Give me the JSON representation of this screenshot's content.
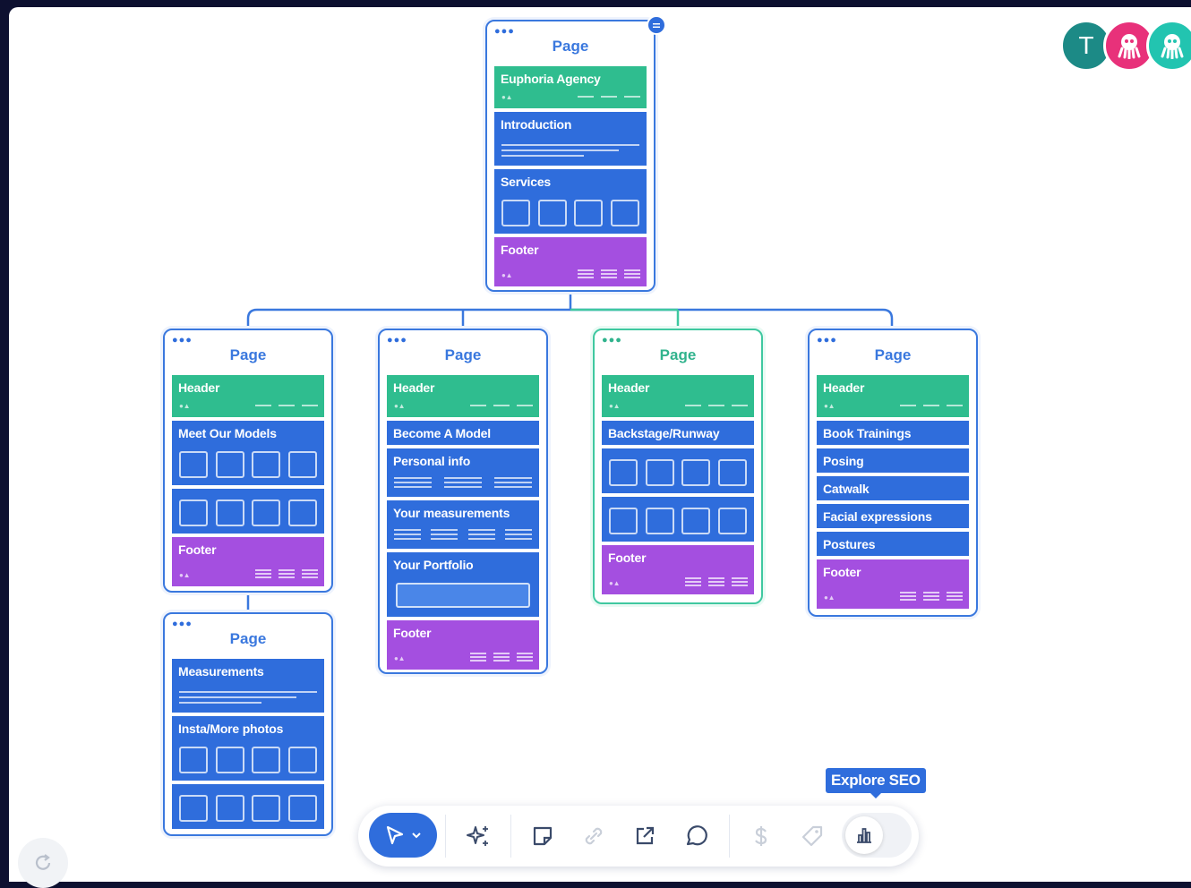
{
  "pages": {
    "root": {
      "title": "Page",
      "sections": [
        "Euphoria Agency",
        "Introduction",
        "Services",
        "Footer"
      ]
    },
    "page_a": {
      "title": "Page",
      "sections": [
        "Header",
        "Meet Our Models",
        "Footer"
      ]
    },
    "page_b": {
      "title": "Page",
      "sections": [
        "Header",
        "Become A Model",
        "Personal info",
        "Your measurements",
        "Your Portfolio",
        "Footer"
      ]
    },
    "page_c": {
      "title": "Page",
      "sections": [
        "Header",
        "Backstage/Runway",
        "Footer"
      ]
    },
    "page_d": {
      "title": "Page",
      "sections": [
        "Header",
        "Book Trainings",
        "Posing",
        "Catwalk",
        "Facial expressions",
        "Postures",
        "Footer"
      ]
    },
    "page_e": {
      "title": "Page",
      "sections": [
        "Measurements",
        "Insta/More photos"
      ]
    }
  },
  "collaborators": [
    {
      "initial": "T",
      "color": "#1c8a86"
    },
    {
      "icon": "octopus-avatar-icon",
      "color": "#e8317a"
    },
    {
      "icon": "octopus-avatar-icon",
      "color": "#22c4b0"
    }
  ],
  "toolbar": {
    "tools": [
      "select-cursor-icon",
      "ai-sparkle-icon",
      "sticky-note-icon",
      "link-icon",
      "external-link-icon",
      "comment-icon",
      "dollar-icon",
      "tag-icon",
      "seo-chart-icon"
    ],
    "tooltip": "Explore SEO"
  },
  "colors": {
    "header": "#2fbd8f",
    "section": "#2f6ddc",
    "footer": "#a44fe0",
    "accent": "#3a78de"
  }
}
